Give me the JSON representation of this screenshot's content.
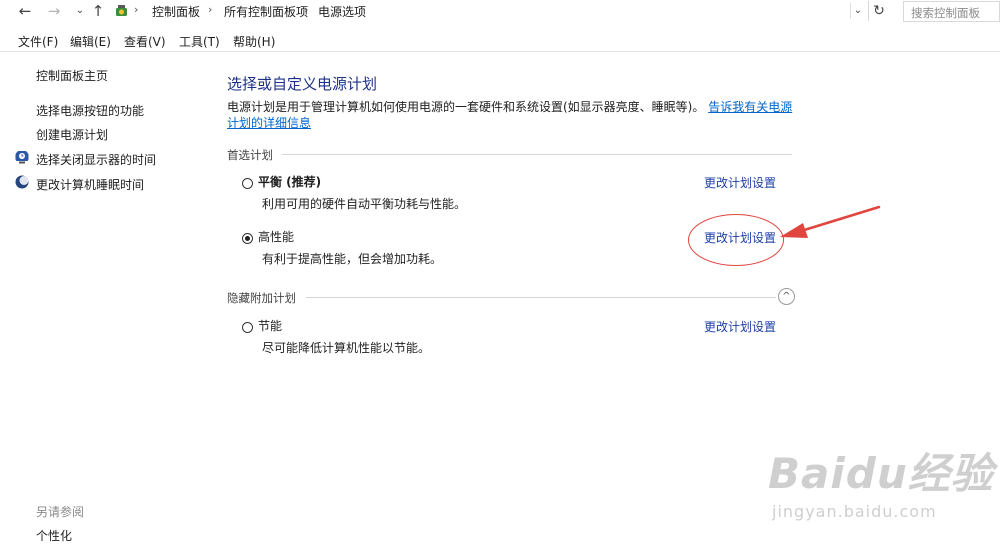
{
  "address_bar": {
    "back_icon": "←",
    "forward_icon": "→",
    "dropdown_icon": "⌄",
    "up_icon": "↑",
    "breadcrumbs": [
      "控制面板",
      "所有控制面板项",
      "电源选项"
    ],
    "separator": "›",
    "expand_icon": "⌄",
    "refresh_icon": "↻",
    "search_placeholder": "搜索控制面板"
  },
  "menu": {
    "items": [
      "文件(F)",
      "编辑(E)",
      "查看(V)",
      "工具(T)",
      "帮助(H)"
    ]
  },
  "sidebar": {
    "home": "控制面板主页",
    "links": [
      "选择电源按钮的功能",
      "创建电源计划",
      "选择关闭显示器的时间",
      "更改计算机睡眠时间"
    ],
    "see_also_title": "另请参阅",
    "see_also_links": [
      "个性化"
    ]
  },
  "main": {
    "title": "选择或自定义电源计划",
    "description": "电源计划是用于管理计算机如何使用电源的一套硬件和系统设置(如显示器亮度、睡眠等)。",
    "description_link": "告诉我有关电源计划的详细信息",
    "preferred_group": {
      "title": "首选计划",
      "plans": [
        {
          "name": "平衡 (推荐)",
          "description": "利用可用的硬件自动平衡功耗与性能。",
          "selected": false,
          "link": "更改计划设置"
        },
        {
          "name": "高性能",
          "description": "有利于提高性能，但会增加功耗。",
          "selected": true,
          "link": "更改计划设置"
        }
      ]
    },
    "hidden_group": {
      "title": "隐藏附加计划",
      "collapse_icon": "^",
      "plans": [
        {
          "name": "节能",
          "description": "尽可能降低计算机性能以节能。",
          "selected": false,
          "link": "更改计划设置"
        }
      ]
    }
  },
  "watermark": {
    "title": "Baidu经验",
    "url": "jingyan.baidu.com"
  },
  "colors": {
    "link": "#1e3fa6",
    "title": "#1e3287",
    "annotation": "#e0453e"
  }
}
